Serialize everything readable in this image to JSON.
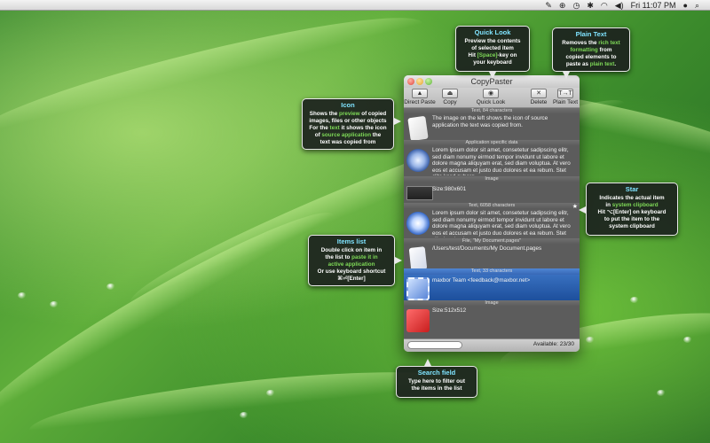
{
  "menubar": {
    "clock": "Fri 11:07 PM",
    "icons": [
      "pin-icon",
      "copypaster-icon",
      "timemachine-icon",
      "bluetooth-icon",
      "wifi-icon",
      "volume-icon",
      "user-icon",
      "spotlight-icon"
    ]
  },
  "window": {
    "title": "CopyPaster",
    "toolbar": {
      "direct_paste": "Direct Paste",
      "copy": "Copy",
      "quick_look": "Quick Look",
      "delete": "Delete",
      "plain_text": "Plain Text"
    },
    "items": [
      {
        "header": "Text, 84 characters",
        "body": "The image on the left shows the icon of source application the text was copied from.",
        "icon": "text-document-icon"
      },
      {
        "header": "Application specific data",
        "body": "Lorem ipsum dolor sit amet, consetetur sadipscing elitr, sed diam nonumy eirmod tempor invidunt ut labore et dolore magna aliquyam erat, sed diam voluptua. At vero eos et accusam et justo duo dolores et ea rebum. Stet clita kasd guberg",
        "icon": "compass-app-icon"
      },
      {
        "header": "Image",
        "body": "Size:980x601",
        "icon": "image-thumbnail-icon"
      },
      {
        "header": "Text, 6058 characters",
        "body": "Lorem ipsum dolor sit amet, consetetur sadipscing elitr, sed diam nonumy eirmod tempor invidunt ut labore et dolore magna aliquyam erat, sed diam voluptua. At vero eos et accusam et justo duo dolores et ea rebum. Stet clita kasd guberg",
        "icon": "safari-icon"
      },
      {
        "header": "File, \"My Document.pages\"",
        "body": "/Users/test/Documents/My Document.pages",
        "icon": "pages-document-icon"
      },
      {
        "header": "Text, 33 characters",
        "body": "maxbor Team <feedback@maxbor.net>",
        "icon": "mail-stamp-icon"
      },
      {
        "header": "Image",
        "body": "Size:512x512",
        "icon": "pushpin-icon"
      }
    ],
    "search_placeholder": "",
    "available": "Available: 23/30"
  },
  "callouts": {
    "quick_look": {
      "title": "Quick Look",
      "l1": "Preview the contents",
      "l2": "of selected item",
      "l3a": "Hit ",
      "l3b": "[Space]",
      "l3c": "-key on",
      "l4": "your keyboard"
    },
    "plain_text": {
      "title": "Plain Text",
      "l1a": "Removes the ",
      "l1b": "rich text",
      "l2": "formatting",
      "l3": "from",
      "l4": "copied elements to",
      "l5a": "paste as ",
      "l5b": "plain text",
      "l5c": "."
    },
    "icon": {
      "title": "Icon",
      "l1a": "Shows the ",
      "l1b": "preview",
      "l1c": " of copied",
      "l2": "images, files or other objects",
      "l3a": "For the ",
      "l3b": "text",
      "l3c": " it shows the icon",
      "l4a": "of ",
      "l4b": "source application",
      "l4c": " the",
      "l5": "text was copied from"
    },
    "star": {
      "title": "Star",
      "l1": "Indicates the actual item",
      "l2a": "in ",
      "l2b": "system clipboard",
      "l3": "Hit ⌥[Enter] on keyboard",
      "l4": "to put the item to the",
      "l5": "system clipboard"
    },
    "items_list": {
      "title": "Items list",
      "l1": "Double click on item in",
      "l2a": "the list to ",
      "l2b": "paste it in",
      "l3": "active application",
      "l4": "Or use keyboard shortcut",
      "l5": "⌘⏎[Enter]"
    },
    "search_field": {
      "title": "Search field",
      "l1": "Type here to filter out",
      "l2": "the items in the list"
    }
  }
}
